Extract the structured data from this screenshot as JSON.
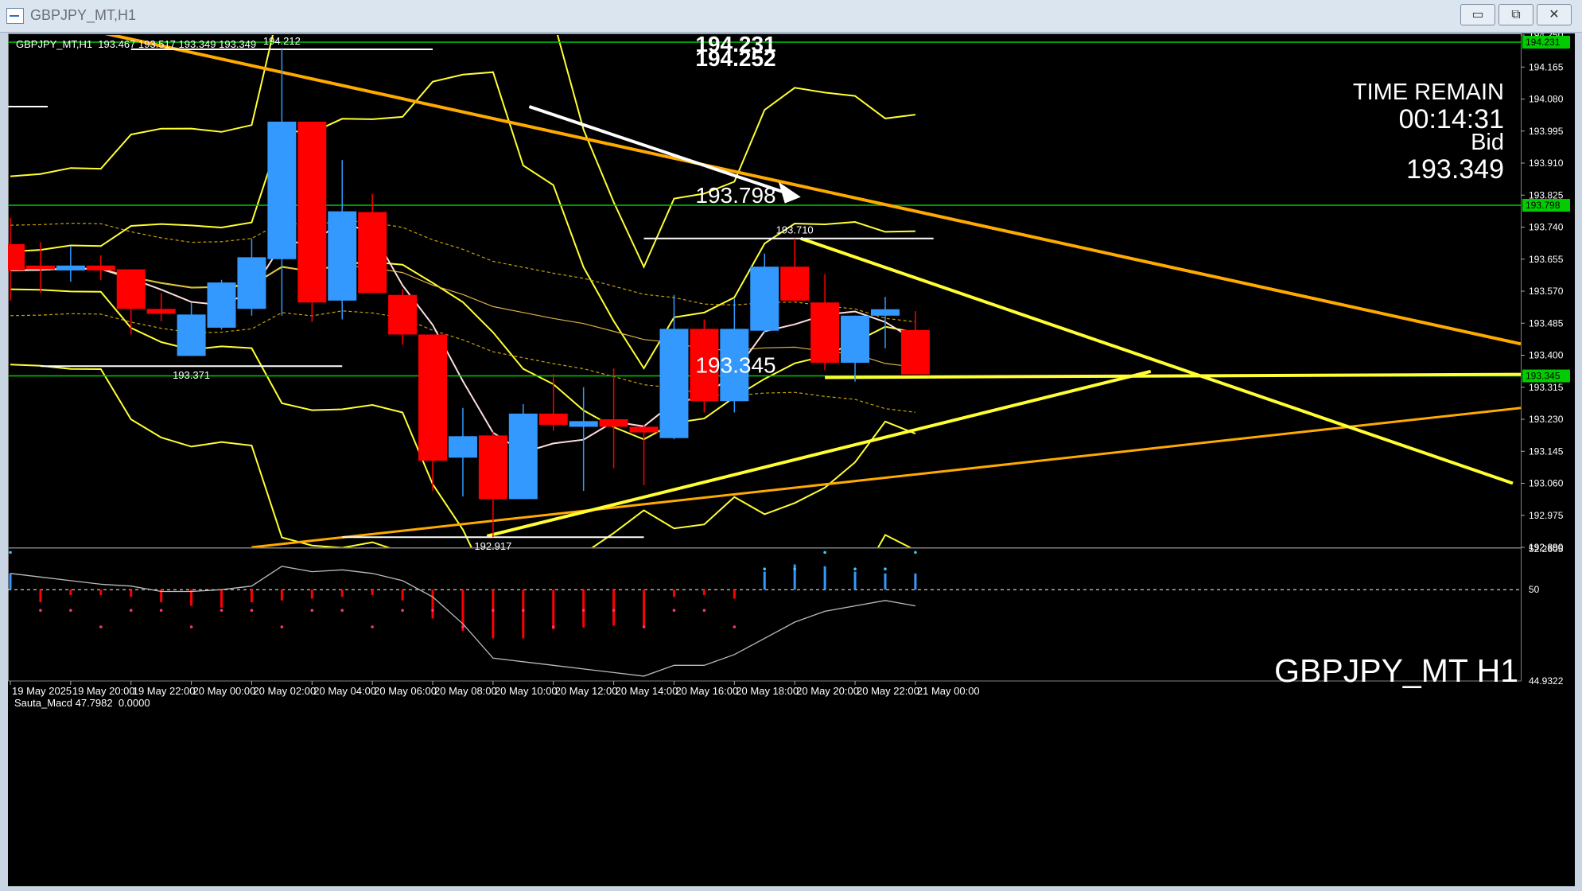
{
  "window": {
    "title": "GBPJPY_MT,H1",
    "buttons": {
      "minimize": "▭",
      "restore": "⧉",
      "close": "✕"
    },
    "icon": "chart-app-icon"
  },
  "header": {
    "symbol_line": "GBPJPY_MT,H1  193.467 193.517 193.349 193.349",
    "time_remain_label": "TIME REMAIN",
    "time_remain_value": "00:14:31",
    "bid_label": "Bid",
    "bid_value": "193.349",
    "watermark": "GBPJPY_MT H1"
  },
  "colors": {
    "background": "#000000",
    "bull": "#3399ff",
    "bear": "#ff0000",
    "band": "#ffff33",
    "trend_orange": "#ffaa00",
    "ma_pink": "#ffdddd",
    "level_green": "#00cc00",
    "white": "#ffffff"
  },
  "chart_data": [
    {
      "type": "candlestick",
      "symbol": "GBPJPY_MT",
      "timeframe": "H1",
      "ylim": [
        192.89,
        194.25
      ],
      "y_ticks": [
        "194.250",
        "194.165",
        "194.080",
        "193.995",
        "193.910",
        "193.825",
        "193.740",
        "193.655",
        "193.570",
        "193.485",
        "193.400",
        "193.315",
        "193.230",
        "193.145",
        "193.060",
        "192.975",
        "192.890"
      ],
      "x_tick_labels": [
        "19 May 2025",
        "19 May 20:00",
        "19 May 22:00",
        "20 May 00:00",
        "20 May 02:00",
        "20 May 04:00",
        "20 May 06:00",
        "20 May 08:00",
        "20 May 10:00",
        "20 May 12:00",
        "20 May 14:00",
        "20 May 16:00",
        "20 May 18:00",
        "20 May 20:00",
        "20 May 22:00",
        "21 May 00:00"
      ],
      "candles": [
        {
          "o": 193.695,
          "h": 193.765,
          "l": 193.545,
          "c": 193.625
        },
        {
          "o": 193.638,
          "h": 193.7,
          "l": 193.565,
          "c": 193.628
        },
        {
          "o": 193.625,
          "h": 193.69,
          "l": 193.595,
          "c": 193.638
        },
        {
          "o": 193.638,
          "h": 193.665,
          "l": 193.6,
          "c": 193.625
        },
        {
          "o": 193.628,
          "h": 193.628,
          "l": 193.455,
          "c": 193.523
        },
        {
          "o": 193.523,
          "h": 193.565,
          "l": 193.49,
          "c": 193.51
        },
        {
          "o": 193.398,
          "h": 193.54,
          "l": 193.4,
          "c": 193.508
        },
        {
          "o": 193.473,
          "h": 193.6,
          "l": 193.468,
          "c": 193.593
        },
        {
          "o": 193.523,
          "h": 193.71,
          "l": 193.505,
          "c": 193.66
        },
        {
          "o": 193.655,
          "h": 194.212,
          "l": 193.505,
          "c": 194.02
        },
        {
          "o": 194.02,
          "h": 194.02,
          "l": 193.488,
          "c": 193.54
        },
        {
          "o": 193.545,
          "h": 193.918,
          "l": 193.495,
          "c": 193.782
        },
        {
          "o": 193.78,
          "h": 193.828,
          "l": 193.565,
          "c": 193.565
        },
        {
          "o": 193.56,
          "h": 193.575,
          "l": 193.428,
          "c": 193.455
        },
        {
          "o": 193.455,
          "h": 193.455,
          "l": 193.04,
          "c": 193.12
        },
        {
          "o": 193.128,
          "h": 193.26,
          "l": 193.025,
          "c": 193.185
        },
        {
          "o": 193.187,
          "h": 193.197,
          "l": 192.917,
          "c": 193.018
        },
        {
          "o": 193.018,
          "h": 193.27,
          "l": 193.02,
          "c": 193.245
        },
        {
          "o": 193.245,
          "h": 193.35,
          "l": 193.2,
          "c": 193.215
        },
        {
          "o": 193.21,
          "h": 193.315,
          "l": 193.04,
          "c": 193.225
        },
        {
          "o": 193.23,
          "h": 193.365,
          "l": 193.1,
          "c": 193.21
        },
        {
          "o": 193.21,
          "h": 193.215,
          "l": 193.055,
          "c": 193.195
        },
        {
          "o": 193.18,
          "h": 193.56,
          "l": 193.177,
          "c": 193.47
        },
        {
          "o": 193.47,
          "h": 193.495,
          "l": 193.248,
          "c": 193.278
        },
        {
          "o": 193.278,
          "h": 193.55,
          "l": 193.248,
          "c": 193.47
        },
        {
          "o": 193.465,
          "h": 193.67,
          "l": 193.46,
          "c": 193.635
        },
        {
          "o": 193.635,
          "h": 193.71,
          "l": 193.54,
          "c": 193.545
        },
        {
          "o": 193.54,
          "h": 193.615,
          "l": 193.36,
          "c": 193.38
        },
        {
          "o": 193.38,
          "h": 193.505,
          "l": 193.33,
          "c": 193.505
        },
        {
          "o": 193.505,
          "h": 193.555,
          "l": 193.418,
          "c": 193.522
        },
        {
          "o": 193.467,
          "h": 193.517,
          "l": 193.349,
          "c": 193.349
        }
      ],
      "hlines": [
        {
          "price": 194.231,
          "label": "194.231"
        },
        {
          "price": 193.798,
          "label": "193.798"
        },
        {
          "price": 193.345,
          "label": "193.345"
        }
      ],
      "hline_extra_label": "194.252",
      "swing_labels": [
        {
          "price": 194.212,
          "label": "194.212"
        },
        {
          "price": 193.71,
          "label": "193.710"
        },
        {
          "price": 193.371,
          "label": "193.371"
        },
        {
          "price": 192.917,
          "label": "192.917"
        }
      ],
      "axis_tags": [
        "194.231",
        "193.798",
        "193.345"
      ]
    },
    {
      "type": "line",
      "name": "Sauta_Macd",
      "indicator_line": "Sauta_Macd 47.7982  0.0000",
      "ylim": [
        44.9322,
        52.2605
      ],
      "y_ticks": [
        "52.2605",
        "50",
        "44.9322"
      ],
      "level": 50,
      "histogram": [
        0.9,
        -0.7,
        -0.3,
        -0.3,
        -0.4,
        -0.7,
        -0.9,
        -1.0,
        -0.7,
        -0.6,
        -0.5,
        -0.4,
        -0.3,
        -0.6,
        -1.6,
        -2.3,
        -2.7,
        -2.7,
        -2.2,
        -2.1,
        -2.0,
        -2.1,
        -0.4,
        -0.3,
        -0.5,
        1.0,
        1.4,
        1.3,
        1.0,
        0.9,
        0.9
      ],
      "signal": [
        50.9,
        50.7,
        50.5,
        50.3,
        50.2,
        49.9,
        49.9,
        50.0,
        50.2,
        51.3,
        51.0,
        51.1,
        50.9,
        50.5,
        49.6,
        48.1,
        46.2,
        46.0,
        45.8,
        45.6,
        45.4,
        45.2,
        45.8,
        45.8,
        46.4,
        47.3,
        48.2,
        48.8,
        49.1,
        49.4,
        49.1
      ]
    }
  ]
}
